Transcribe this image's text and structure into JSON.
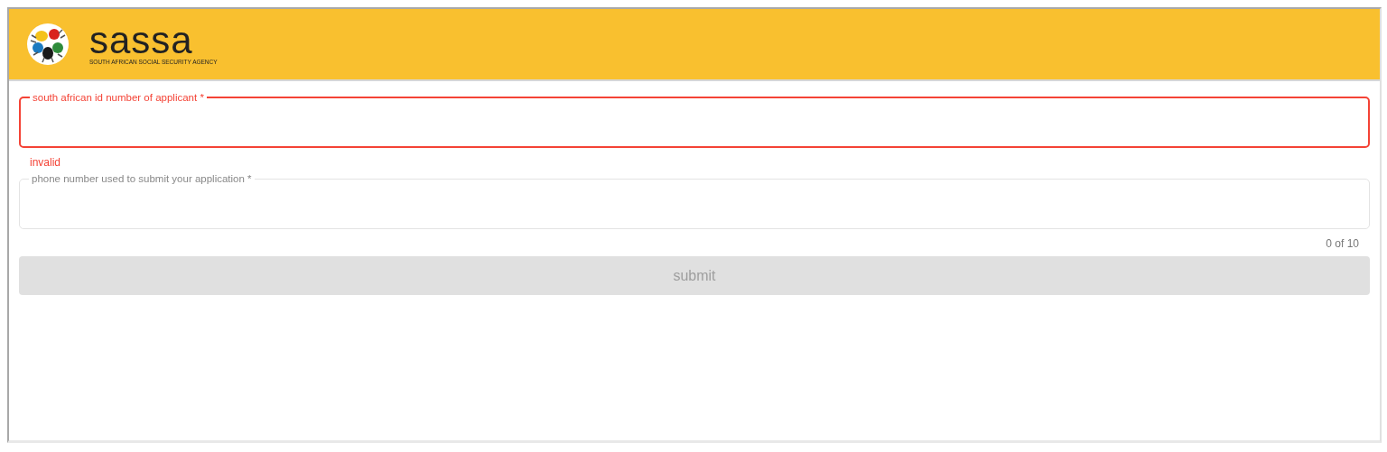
{
  "header": {
    "brand": "sassa",
    "tagline": "SOUTH AFRICAN SOCIAL SECURITY AGENCY"
  },
  "fields": [
    {
      "label": "south african id number of applicant *",
      "error": true,
      "focused": true,
      "message": "invalid"
    },
    {
      "label": "phone number used to submit your application *",
      "error": false,
      "focused": false,
      "counter": "0 of 10"
    }
  ],
  "submit": {
    "label": "submit",
    "disabled": true
  }
}
